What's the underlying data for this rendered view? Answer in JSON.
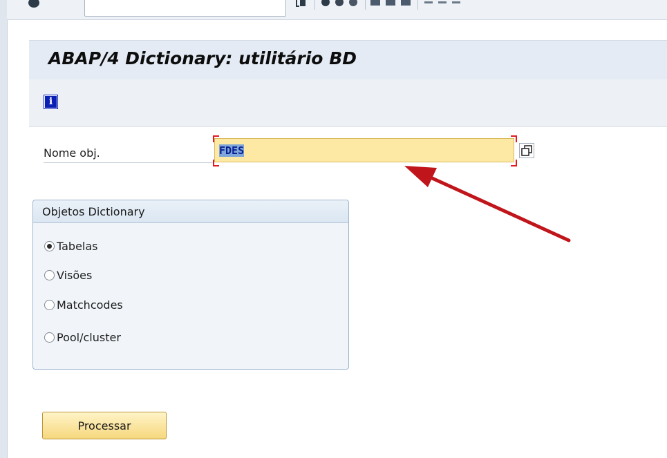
{
  "title": "ABAP/4 Dictionary: utilitário BD",
  "app_toolbar": {
    "info_icon_glyph": "i"
  },
  "object_field": {
    "label": "Nome obj.",
    "value": "FDES"
  },
  "dictionary_objects": {
    "title": "Objetos Dictionary",
    "options": [
      {
        "label": "Tabelas",
        "selected": true
      },
      {
        "label": "Visões",
        "selected": false
      },
      {
        "label": "Matchcodes",
        "selected": false
      },
      {
        "label": "Pool/cluster",
        "selected": false
      }
    ]
  },
  "process_button": {
    "label": "Processar"
  },
  "colors": {
    "field_background": "#fde9a3",
    "field_focus_bracket": "#e2191e",
    "annotation_arrow": "#c0151b",
    "title_bar": "#e4ebf4",
    "button_gradient_top": "#fff4c8",
    "button_gradient_bottom": "#f6d77d"
  }
}
